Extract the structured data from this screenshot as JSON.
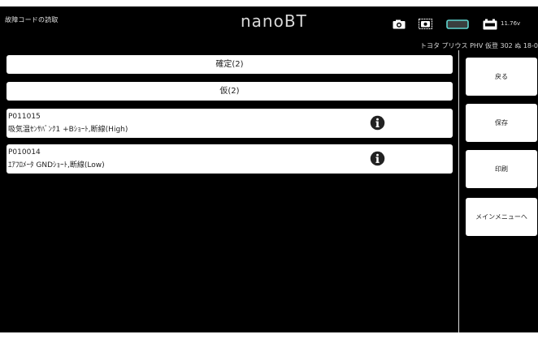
{
  "header": {
    "screen_title": "故障コードの読取",
    "brand": "nanoBT",
    "voltage": "11.76v"
  },
  "vehicle_info": "トヨタ プリウス PHV 仮登 302 ぬ 18-0",
  "groups": {
    "confirmed_label": "確定(2)",
    "pending_label": "仮(2)"
  },
  "codes": [
    {
      "code": "P011015",
      "description": "吸気温ｾﾝｻﾊﾞﾝｸ1 +Bｼｮｰﾄ,断線(High)"
    },
    {
      "code": "P010014",
      "description": "ｴｱﾌﾛﾒｰﾀ GNDｼｮｰﾄ,断線(Low)"
    }
  ],
  "side_buttons": {
    "back": "戻る",
    "save": "保存",
    "print": "印刷",
    "main_menu": "メインメニューへ"
  },
  "colors": {
    "background": "#000000",
    "panel": "#ffffff",
    "connection_accent": "#5fd6d0",
    "info_icon": "#222222"
  },
  "icons": [
    "camera-icon",
    "screenshot-icon",
    "connection-icon",
    "battery-icon",
    "info-icon"
  ]
}
